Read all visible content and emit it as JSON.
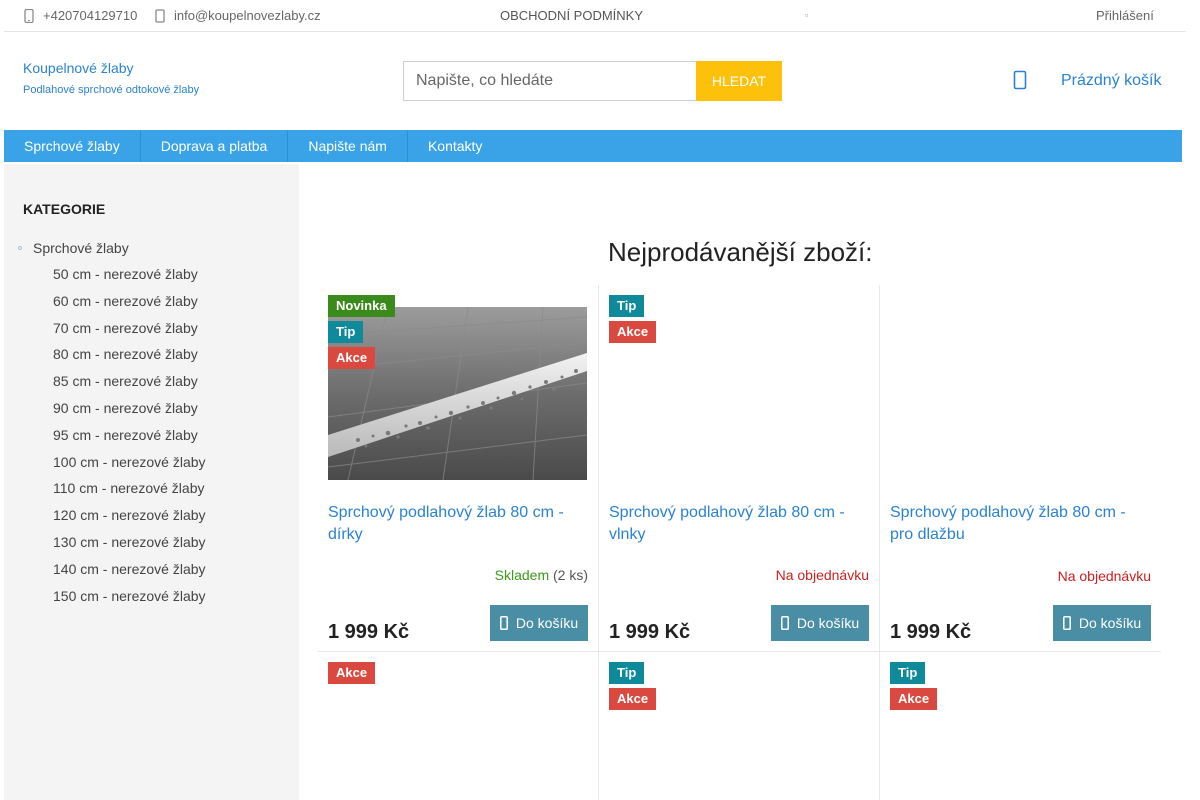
{
  "topbar": {
    "phone": "+420704129710",
    "email": "info@koupelnovezlaby.cz",
    "terms": "OBCHODNÍ PODMÍNKY",
    "login": "Přihlášení"
  },
  "header": {
    "logo_title": "Koupelnové žlaby",
    "logo_subtitle": "Podlahové sprchové odtokové žlaby",
    "search_placeholder": "Napište, co hledáte",
    "search_button": "HLEDAT",
    "cart_label": "Prázdný košík"
  },
  "nav": {
    "items": [
      "Sprchové žlaby",
      "Doprava a platba",
      "Napište nám",
      "Kontakty"
    ]
  },
  "sidebar": {
    "title": "KATEGORIE",
    "main_category": "Sprchové žlaby",
    "subcategories": [
      "50 cm - nerezové žlaby",
      "60 cm - nerezové žlaby",
      "70 cm - nerezové žlaby",
      "80 cm - nerezové žlaby",
      "85 cm - nerezové žlaby",
      "90 cm - nerezové žlaby",
      "95 cm - nerezové žlaby",
      "100 cm - nerezové žlaby",
      "110 cm - nerezové žlaby",
      "120 cm - nerezové žlaby",
      "130 cm - nerezové žlaby",
      "140 cm - nerezové žlaby",
      "150 cm - nerezové žlaby"
    ]
  },
  "main": {
    "section_title": "Nejprodávanější zboží:",
    "buy_label": "Do košíku",
    "products": [
      {
        "flags": [
          "Novinka",
          "Tip",
          "Akce"
        ],
        "name": "Sprchový podlahový žlab 80 cm - dírky",
        "availability": "Skladem",
        "quantity": "(2 ks)",
        "price": "1 999 Kč"
      },
      {
        "flags": [
          "Tip",
          "Akce"
        ],
        "name": "Sprchový podlahový žlab 80 cm - vlnky",
        "availability": "Na objednávku",
        "quantity": "",
        "price": "1 999 Kč"
      },
      {
        "flags": [],
        "name": "Sprchový podlahový žlab 80 cm - pro dlažbu",
        "availability": "Na objednávku",
        "quantity": "",
        "price": "1 999 Kč"
      },
      {
        "flags": [
          "Akce"
        ],
        "name": "",
        "availability": "",
        "quantity": "",
        "price": ""
      },
      {
        "flags": [
          "Tip",
          "Akce"
        ],
        "name": "",
        "availability": "",
        "quantity": "",
        "price": ""
      },
      {
        "flags": [
          "Tip",
          "Akce"
        ],
        "name": "",
        "availability": "",
        "quantity": "",
        "price": ""
      }
    ]
  },
  "colors": {
    "link": "#2a83d1",
    "nav": "#3aa3e8",
    "search_button": "#fec10b",
    "buy_button": "#4a8ea5",
    "flag_novinka": "#3b8a1c",
    "flag_tip": "#0e8a9a",
    "flag_akce": "#d9493f",
    "in_stock": "#3b9a1c",
    "on_order": "#cc1f1f"
  }
}
